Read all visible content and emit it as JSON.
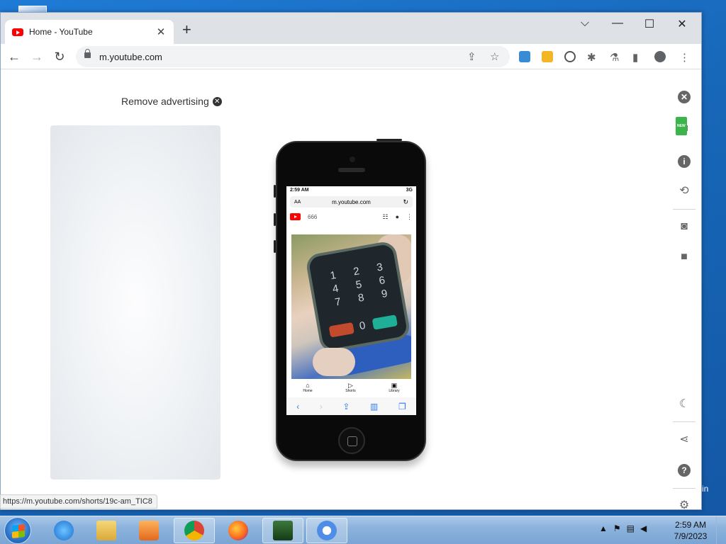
{
  "browser": {
    "tab": {
      "title": "Home - YouTube",
      "close": "✕"
    },
    "new_tab": "+",
    "window_controls": {
      "dropdown": "⌵",
      "minimize": "—",
      "maximize": "☐",
      "close": "✕"
    },
    "nav": {
      "back": "←",
      "forward": "→",
      "reload": "↻"
    },
    "omnibox": {
      "url": "m.youtube.com"
    },
    "status_url": "https://m.youtube.com/shorts/19c-am_TIC8"
  },
  "page": {
    "remove_ad_label": "Remove advertising",
    "phone": {
      "status_time": "2:59 AM",
      "status_network": "3G",
      "address_aa": "AA",
      "address_url": "m.youtube.com",
      "search_query": "666",
      "video_keys": [
        "1",
        "2",
        "3",
        "4",
        "5",
        "6",
        "7",
        "8",
        "9"
      ],
      "video_zero": "0",
      "tabbar": [
        {
          "icon": "home-icon",
          "label": "Home"
        },
        {
          "icon": "shorts-icon",
          "label": "Shorts"
        },
        {
          "icon": "library-icon",
          "label": "Library"
        }
      ]
    },
    "sidebar": {
      "new_badge": "NEW"
    }
  },
  "taskbar": {
    "clock_time": "2:59 AM",
    "clock_date": "7/9/2023"
  },
  "desktop": {
    "partial_label": "in"
  },
  "colors": {
    "youtube_red": "#ff0000",
    "chrome_frame": "#dee1e6",
    "taskbar": "#8cb3dd"
  }
}
